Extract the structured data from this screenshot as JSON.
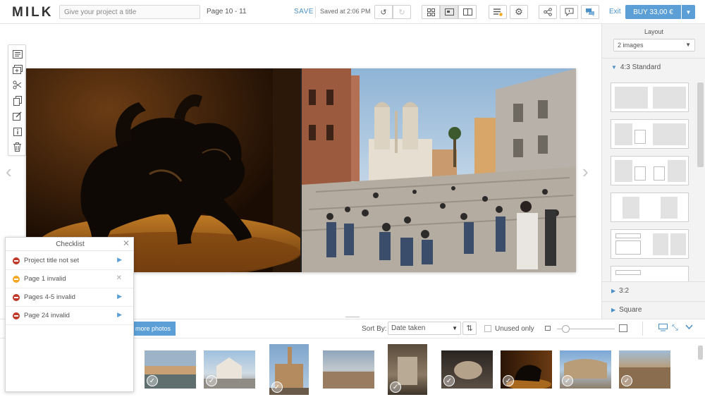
{
  "app": {
    "logo": "MILK",
    "title_placeholder": "Give your project a title",
    "page_indicator": "Page 10 - 11",
    "save_label": "SAVE",
    "saved_at": "Saved at 2:06 PM",
    "exit_label": "Exit",
    "buy_label": "BUY 33,00 €",
    "colors": {
      "accent": "#5b9fd6",
      "link": "#4a90c8",
      "error": "#c0392b",
      "warning": "#f5a623"
    }
  },
  "toolbar": {
    "undo_icon": "undo-icon",
    "redo_icon": "redo-icon",
    "view_icons": [
      "grid-view-icon",
      "spread-view-icon",
      "book-view-icon"
    ],
    "tools_icons": [
      "checklist-icon",
      "settings-icon"
    ],
    "share_icons": [
      "share-icon",
      "comment-icon",
      "chat-icon"
    ]
  },
  "side_tools": [
    "text-icon",
    "add-page-icon",
    "crop-icon",
    "copy-icon",
    "edit-icon",
    "info-icon",
    "trash-icon"
  ],
  "layout_panel": {
    "title": "Layout",
    "image_count": "2 images",
    "sections": {
      "standard": "4:3 Standard",
      "ratio32": "3:2",
      "square": "Square"
    }
  },
  "strip": {
    "more_photos": "more photos",
    "sort_by_label": "Sort By:",
    "sort_value": "Date taken",
    "unused_only": "Unused only",
    "photo_count": 10
  },
  "checklist": {
    "title": "Checklist",
    "items": [
      {
        "label": "Project title not set",
        "status": "error"
      },
      {
        "label": "Page 1 invalid",
        "status": "warning"
      },
      {
        "label": "Pages 4-5 invalid",
        "status": "error"
      },
      {
        "label": "Page 24 invalid",
        "status": "error"
      }
    ]
  }
}
